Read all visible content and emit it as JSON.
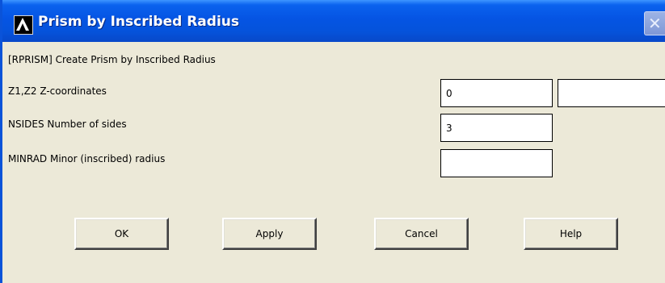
{
  "window": {
    "title": "Prism by Inscribed Radius",
    "close_glyph": "✕"
  },
  "dialog": {
    "command_label": "[RPRISM]  Create Prism by Inscribed Radius",
    "fields": {
      "z_coords_label": "Z1,Z2  Z-coordinates",
      "z1_value": "0",
      "z2_value": "",
      "nsides_label": "NSIDES  Number of sides",
      "nsides_value": "3",
      "minrad_label": "MINRAD  Minor (inscribed) radius",
      "minrad_value": ""
    }
  },
  "buttons": {
    "ok": "OK",
    "apply": "Apply",
    "cancel": "Cancel",
    "help": "Help"
  },
  "icons": {
    "app_icon": "ansys-logo-icon",
    "close_icon": "close-icon"
  },
  "colors": {
    "titlebar": "#0554e3",
    "dialog_bg": "#ece9d8"
  }
}
